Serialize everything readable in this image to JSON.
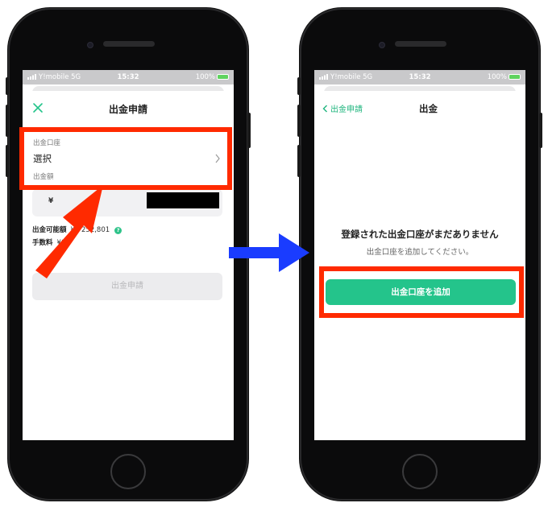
{
  "left_screen": {
    "status_bar": {
      "carrier": "Y!mobile 5G",
      "time": "15:32",
      "battery": "100%"
    },
    "nav_title": "出金申請",
    "account_label": "出金口座",
    "select_value": "選択",
    "amount_label": "出金額",
    "currency_symbol": "¥",
    "available_label": "出金可能額",
    "available_value": "¥4 252,801",
    "fee_label": "手数料",
    "fee_value": "¥0",
    "submit_label": "出金申請"
  },
  "right_screen": {
    "status_bar": {
      "carrier": "Y!mobile 5G",
      "time": "15:32",
      "battery": "100%"
    },
    "back_label": "出金申請",
    "nav_title": "出金",
    "empty_title": "登録された出金口座がまだありません",
    "empty_subtitle": "出金口座を追加してください。",
    "add_button_label": "出金口座を追加"
  },
  "colors": {
    "accent_green": "#24c48b",
    "highlight_red": "#ff2a00",
    "arrow_red": "#ff2a00",
    "arrow_blue": "#1a3cff"
  },
  "icons": {
    "close": "close-icon",
    "chevron_right": "chevron-right-icon",
    "chevron_left": "chevron-left-icon",
    "help": "help-icon"
  }
}
